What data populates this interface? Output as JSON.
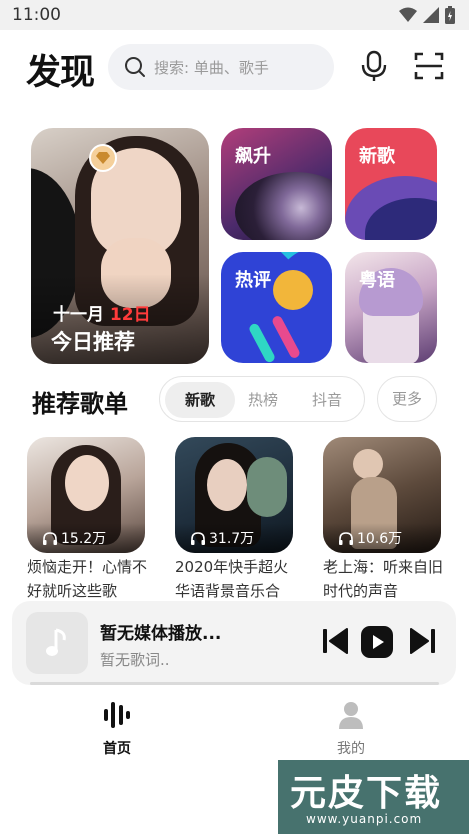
{
  "status": {
    "time": "11:00"
  },
  "header": {
    "logo": "发现",
    "search_placeholder": "搜索: 单曲、歌手"
  },
  "banner": {
    "featured": {
      "date_prefix": "十一月",
      "date_day": "12日",
      "label": "今日推荐"
    },
    "tiles": [
      {
        "label": "飙升"
      },
      {
        "label": "新歌"
      },
      {
        "label": "热评"
      },
      {
        "label": "粤语"
      }
    ]
  },
  "section": {
    "title": "推荐歌单",
    "tabs": [
      "新歌",
      "热榜",
      "抖音"
    ],
    "active_tab": "新歌",
    "more": "更多"
  },
  "playlists": [
    {
      "plays": "15.2万",
      "title": "烦恼走开！心情不好就听这些歌"
    },
    {
      "plays": "31.7万",
      "title": "2020年快手超火华语背景音乐合"
    },
    {
      "plays": "10.6万",
      "title": "老上海：听来自旧时代的声音"
    }
  ],
  "player": {
    "title": "暂无媒体播放...",
    "lyric": "暂无歌词..",
    "progress": 0
  },
  "nav": {
    "home": "首页",
    "me": "我的"
  },
  "watermark": {
    "text": "元皮下载",
    "url": "www.yuanpi.com"
  },
  "colors": {
    "accent_red": "#ff3b3b",
    "status_bg": "#f1f1f1",
    "player_bg": "#f3f3f3"
  }
}
